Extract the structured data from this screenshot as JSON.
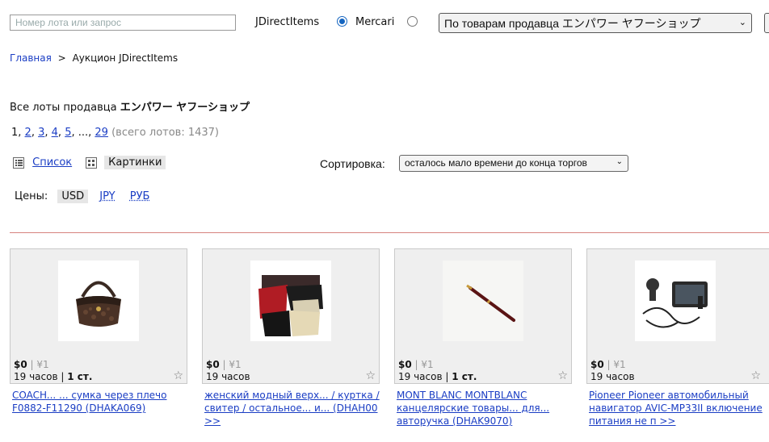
{
  "search": {
    "placeholder": "Номер лота или запрос"
  },
  "sources": [
    {
      "label": "JDirectItems",
      "selected": true
    },
    {
      "label": "Mercari",
      "selected": false
    }
  ],
  "seller_select": {
    "value": "По товарам продавца エンパワー ヤフーショップ"
  },
  "breadcrumb": {
    "home": "Главная",
    "sep": ">",
    "current": "Аукцион JDirectItems"
  },
  "page_title": {
    "prefix": "Все лоты продавца",
    "seller": "エンパワー ヤフーショップ"
  },
  "pagination": {
    "current": "1,",
    "pages": [
      "2",
      "3",
      "4",
      "5"
    ],
    "ellipsis": "...,",
    "last": "29",
    "total": "(всего лотов: 1437)"
  },
  "view": {
    "list_label": "Список",
    "grid_label": "Картинки"
  },
  "sort": {
    "label": "Сортировка:",
    "value": "осталось мало времени до конца торгов"
  },
  "prices": {
    "label": "Цены:",
    "usd": "USD",
    "jpy": "JPY",
    "rub": "РУБ"
  },
  "items": [
    {
      "price": "$0",
      "yen": "¥1",
      "time": "19 часов",
      "bids": "1 ст.",
      "title": "COACH... ... сумка через плечо F0882-F11290 (DHAKA069)"
    },
    {
      "price": "$0",
      "yen": "¥1",
      "time": "19 часов",
      "bids": "",
      "title": "женский модный верх... / куртка / свитер / остальное... и... (DHAH00 >>"
    },
    {
      "price": "$0",
      "yen": "¥1",
      "time": "19 часов",
      "bids": "1 ст.",
      "title": "MONT BLANC MONTBLANC канцелярские товары... для... авторучка (DHAK9070)"
    },
    {
      "price": "$0",
      "yen": "¥1",
      "time": "19 часов",
      "bids": "",
      "title": "Pioneer Pioneer автомобильный навигатор AVIC-MP33II включение питания не п >>"
    }
  ],
  "colors": {
    "link": "#1a3dc4",
    "divider": "#d7827f",
    "radio": "#1565c0"
  }
}
